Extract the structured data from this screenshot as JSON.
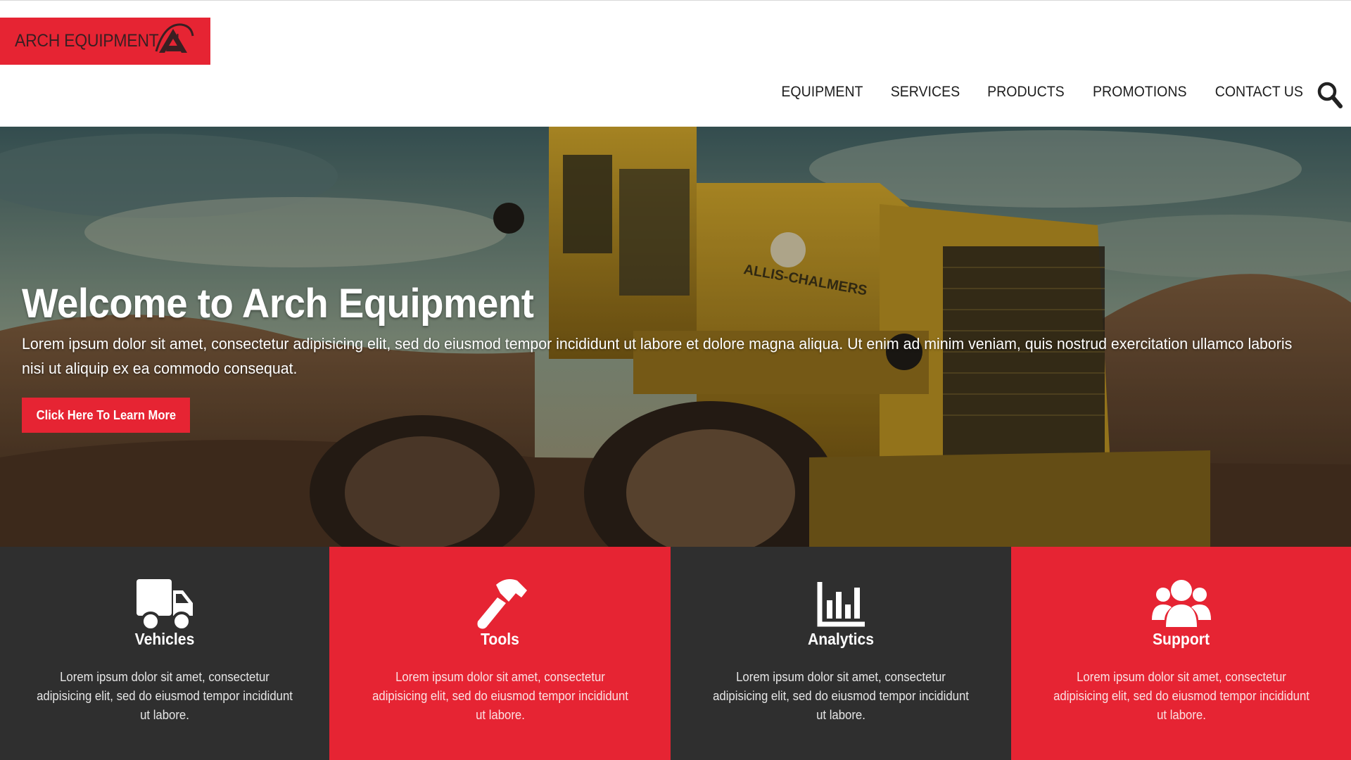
{
  "brand": {
    "name": "ARCH EQUIPMENT",
    "separator": "|",
    "accent_color": "#e62433",
    "logo_icon": "arch-logo-icon"
  },
  "nav": {
    "items": [
      {
        "label": "EQUIPMENT"
      },
      {
        "label": "SERVICES"
      },
      {
        "label": "PRODUCTS"
      },
      {
        "label": "PROMOTIONS"
      },
      {
        "label": "CONTACT US"
      }
    ],
    "search_icon": "search-icon"
  },
  "hero": {
    "title": "Welcome to Arch Equipment",
    "body": "Lorem ipsum dolor sit amet, consectetur adipisicing elit, sed do eiusmod tempor incididunt ut labore et dolore magna aliqua. Ut enim ad minim veniam, quis nostrud exercitation ullamco laboris nisi ut aliquip ex ea commodo consequat.",
    "cta_label": "Click Here To Learn More",
    "machine_badge": "ALLIS-CHALMERS"
  },
  "features": [
    {
      "title": "Vehicles",
      "icon": "truck-icon",
      "text": "Lorem ipsum dolor sit amet, consectetur adipisicing elit, sed do eiusmod tempor incididunt ut labore.",
      "color": "#2f2f2f"
    },
    {
      "title": "Tools",
      "icon": "hammer-icon",
      "text": "Lorem ipsum dolor sit amet, consectetur adipisicing elit, sed do eiusmod tempor incididunt ut labore.",
      "color": "#e62433"
    },
    {
      "title": "Analytics",
      "icon": "bar-chart-icon",
      "text": "Lorem ipsum dolor sit amet, consectetur adipisicing elit, sed do eiusmod tempor incididunt ut labore.",
      "color": "#2f2f2f"
    },
    {
      "title": "Support",
      "icon": "users-icon",
      "text": "Lorem ipsum dolor sit amet, consectetur adipisicing elit, sed do eiusmod tempor incididunt ut labore.",
      "color": "#e62433"
    }
  ]
}
